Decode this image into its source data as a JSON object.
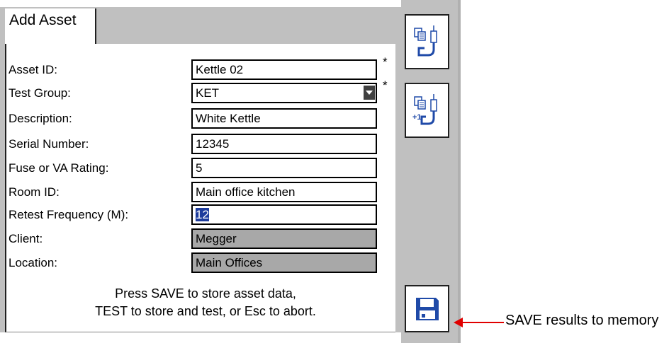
{
  "tab": {
    "label": "Add Asset"
  },
  "form": {
    "rows": [
      {
        "label": "Asset ID:",
        "value": "Kettle 02",
        "required": "*"
      },
      {
        "label": "Test Group:",
        "value": "KET",
        "required": "*"
      },
      {
        "label": "Description:",
        "value": "White Kettle"
      },
      {
        "label": "Serial Number:",
        "value": "12345"
      },
      {
        "label": "Fuse or VA Rating:",
        "value": "5"
      },
      {
        "label": "Room ID:",
        "value": "Main office kitchen"
      },
      {
        "label": "Retest Frequency (M):",
        "value": "12"
      },
      {
        "label": "Client:",
        "value": "Megger"
      },
      {
        "label": "Location:",
        "value": "Main Offices"
      }
    ]
  },
  "message": {
    "line1": "Press SAVE to store asset data,",
    "line2": "TEST to store and test, or Esc to abort."
  },
  "side_buttons": [
    {
      "icon": "copy-asset-icon"
    },
    {
      "icon": "copy-asset-increment-icon",
      "glyph": "+1"
    },
    {
      "icon": "save-floppy-icon"
    }
  ],
  "annotation": {
    "text": "SAVE results to memory"
  },
  "colors": {
    "selection": "#1e3c9c",
    "readonly": "#a8a8a8",
    "arrow": "#e00000",
    "save_icon": "#1f4aa8"
  }
}
